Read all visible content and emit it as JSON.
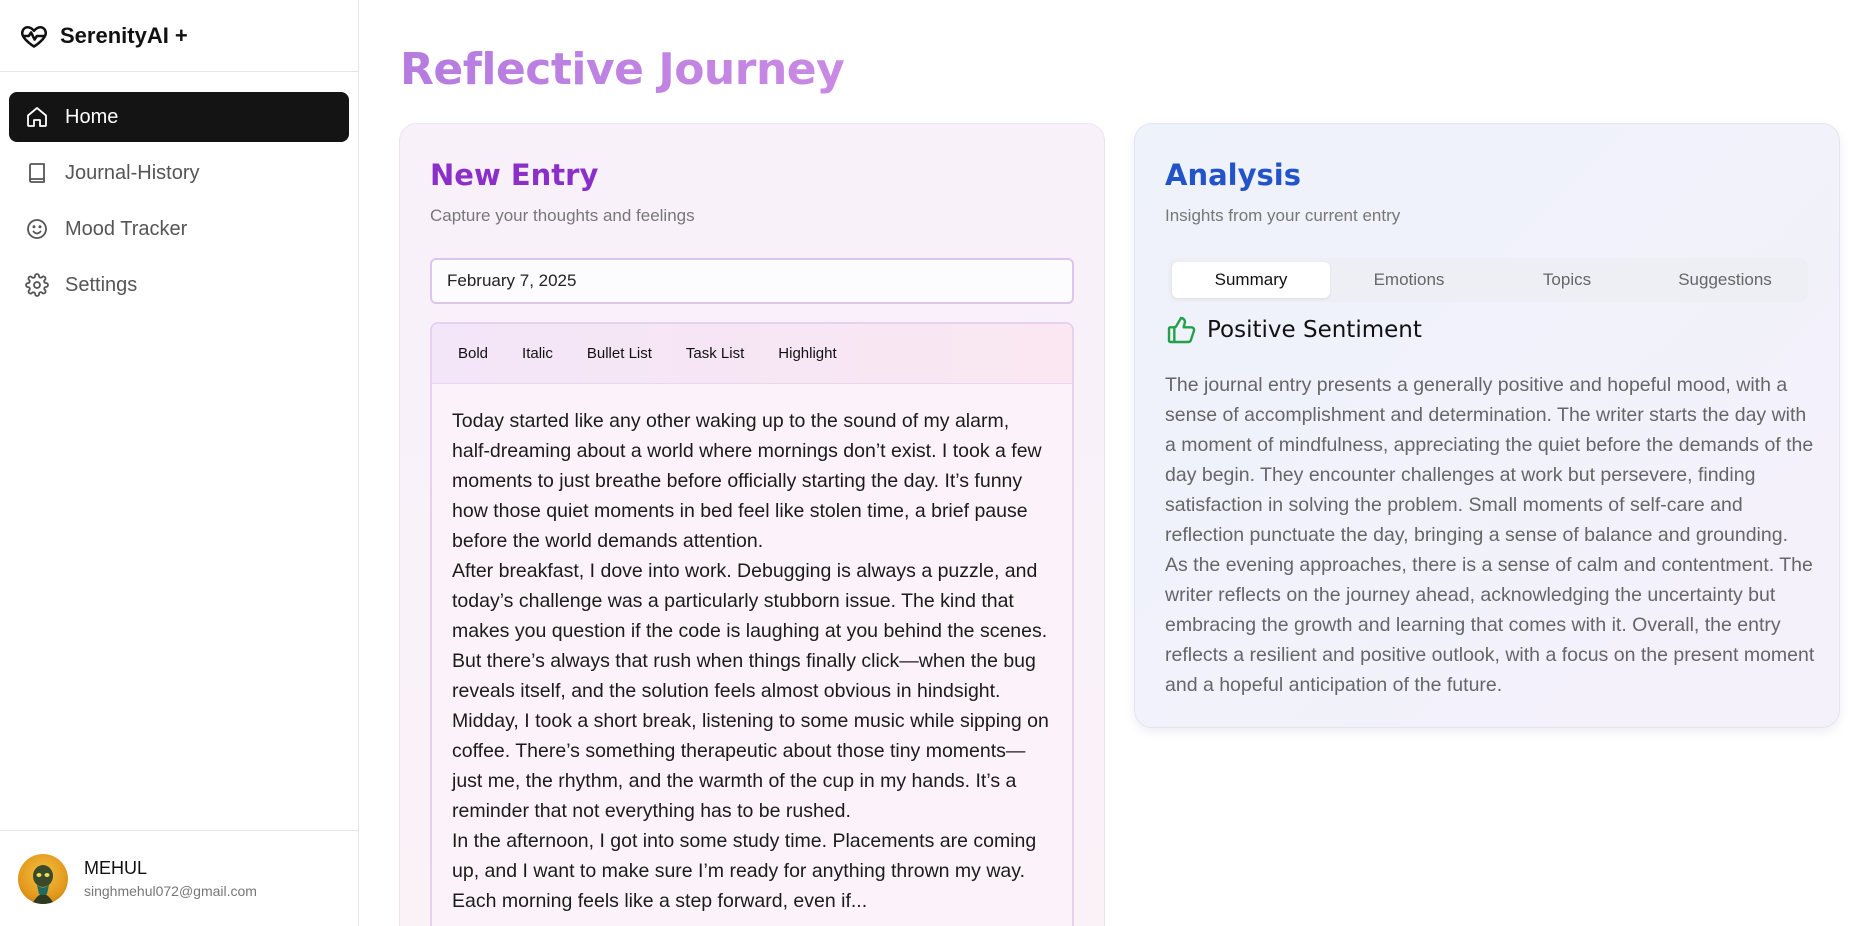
{
  "app": {
    "name": "SerenityAI +"
  },
  "sidebar": {
    "items": [
      {
        "label": "Home",
        "icon": "home-icon",
        "active": true
      },
      {
        "label": "Journal-History",
        "icon": "book-icon",
        "active": false
      },
      {
        "label": "Mood Tracker",
        "icon": "smile-icon",
        "active": false
      },
      {
        "label": "Settings",
        "icon": "gear-icon",
        "active": false
      }
    ]
  },
  "user": {
    "name": "MEHUL",
    "email": "singhmehul072@gmail.com"
  },
  "page": {
    "title": "Reflective Journey"
  },
  "entry": {
    "title": "New Entry",
    "subtitle": "Capture your thoughts and feelings",
    "date": "February 7, 2025",
    "toolbar": [
      "Bold",
      "Italic",
      "Bullet List",
      "Task List",
      "Highlight"
    ],
    "paragraphs": [
      "Today started like any other waking up to the sound of my alarm, half-dreaming about a world where mornings don’t exist. I took a few moments to just breathe before officially starting the day. It’s funny how those quiet moments in bed feel like stolen time, a brief pause before the world demands attention.",
      "After breakfast, I dove into work. Debugging is always a puzzle, and today’s challenge was a particularly stubborn issue. The kind that makes you question if the code is laughing at you behind the scenes. But there’s always that rush when things finally click—when the bug reveals itself, and the solution feels almost obvious in hindsight.",
      "Midday, I took a short break, listening to some music while sipping on coffee. There’s something therapeutic about those tiny moments—just me, the rhythm, and the warmth of the cup in my hands. It’s a reminder that not everything has to be rushed.",
      "In the afternoon, I got into some study time. Placements are coming up, and I want to make sure I’m ready for anything thrown my way. Each morning feels like a step forward, even if..."
    ]
  },
  "analysis": {
    "title": "Analysis",
    "subtitle": "Insights from your current entry",
    "tabs": [
      "Summary",
      "Emotions",
      "Topics",
      "Suggestions"
    ],
    "active_tab": "Summary",
    "sentiment": "Positive Sentiment",
    "summary": "The journal entry presents a generally positive and hopeful mood, with a sense of accomplishment and determination. The writer starts the day with a moment of mindfulness, appreciating the quiet before the demands of the day begin. They encounter challenges at work but persevere, finding satisfaction in solving the problem. Small moments of self-care and reflection punctuate the day, bringing a sense of balance and grounding. As the evening approaches, there is a sense of calm and contentment. The writer reflects on the journey ahead, acknowledging the uncertainty but embracing the growth and learning that comes with it. Overall, the entry reflects a resilient and positive outlook, with a focus on the present moment and a hopeful anticipation of the future."
  },
  "colors": {
    "title_gradient": [
      "#b57be0",
      "#c98ae4"
    ],
    "entry_title": "#8b2fc9",
    "analysis_title": "#2353c9",
    "positive": "#22a04a"
  }
}
